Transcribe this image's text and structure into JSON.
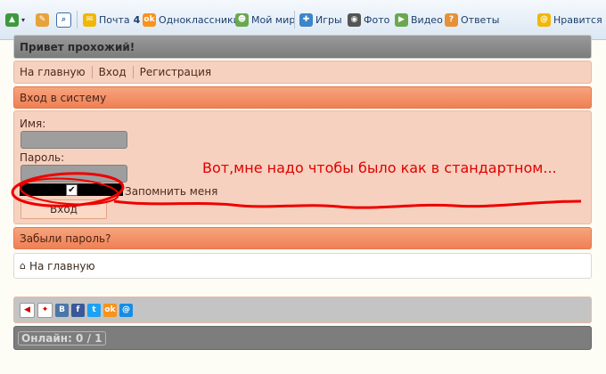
{
  "toolbar": {
    "mail_label": "Почта",
    "mail_count": "4",
    "ok_label": "Одноклассники",
    "mymir_label": "Мой мир",
    "games_label": "Игры",
    "photo_label": "Фото",
    "video_label": "Видео",
    "answers_label": "Ответы",
    "like_label": "Нравится"
  },
  "greeting": "Привет прохожий!",
  "nav": {
    "home": "На главную",
    "login": "Вход",
    "register": "Регистрация"
  },
  "login_panel": {
    "title": "Вход в систему",
    "name_label": "Имя:",
    "password_label": "Пароль:",
    "remember_label": "Запомнить меня",
    "submit_label": "Вход",
    "checkbox_checked": true
  },
  "annotation": "Вот,мне надо чтобы было как  в стандартном...",
  "forgot": "Забыли пароль?",
  "home_link": "На главную",
  "online": "Онлайн: 0 / 1",
  "colors": {
    "accent_orange": "#ef8055",
    "panel_peach": "#f7d1bf",
    "annotation_red": "#e00000"
  }
}
